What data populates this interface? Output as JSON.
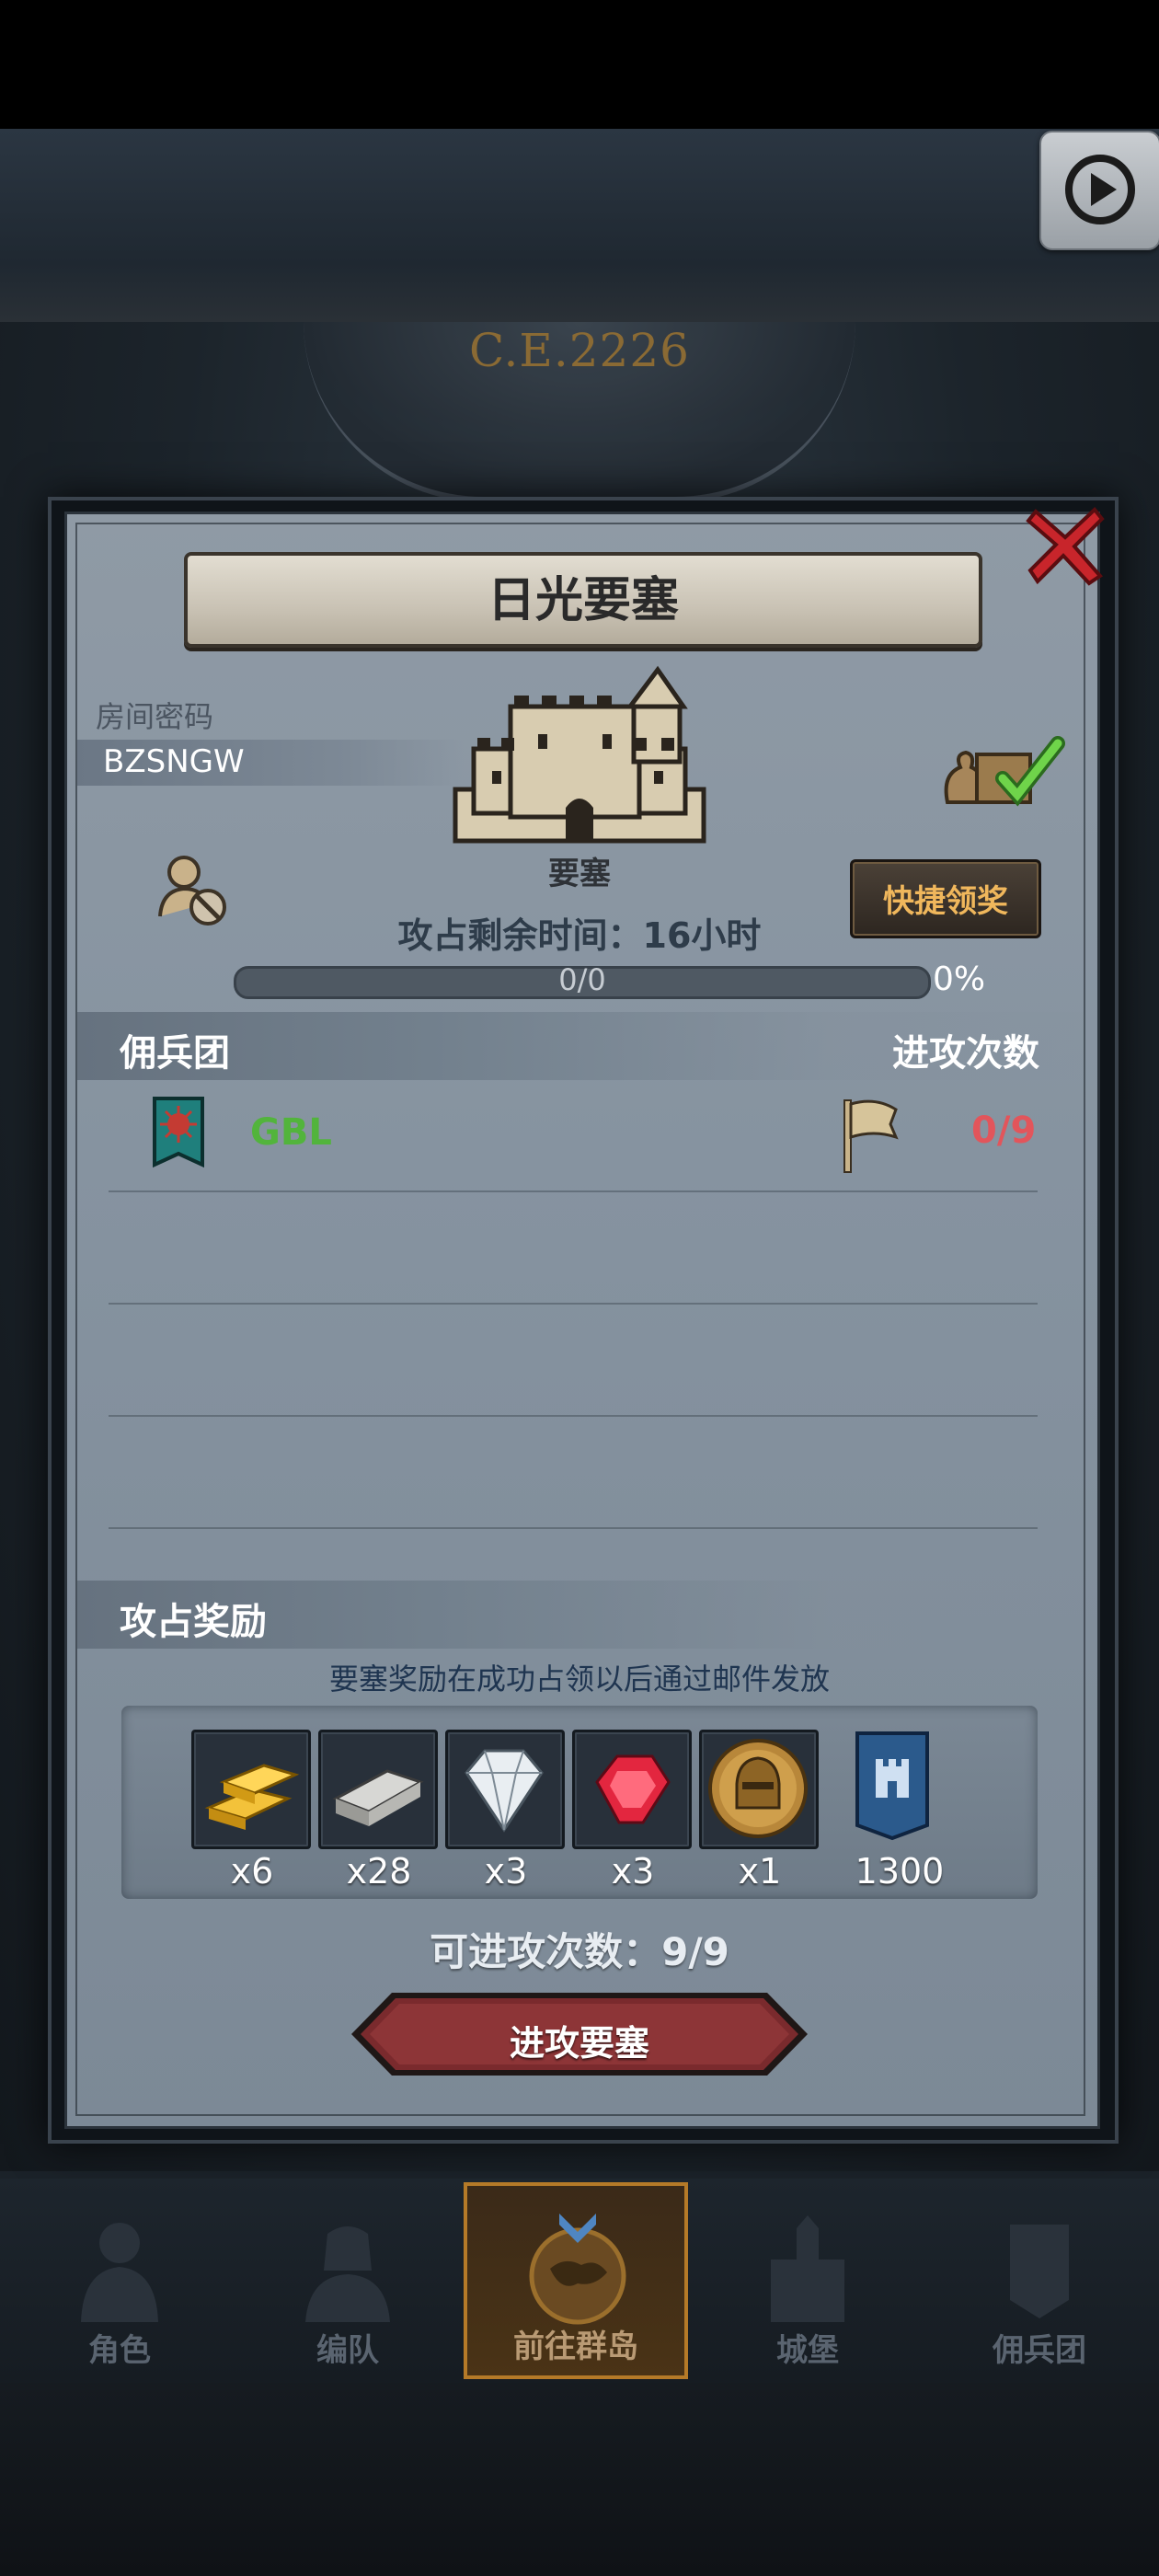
{
  "background": {
    "era_label": "C.E.2226"
  },
  "panel": {
    "title": "日光要塞",
    "room_code_label": "房间密码",
    "room_code": "BZSNGW",
    "fortress_label": "要塞",
    "quick_claim_label": "快捷领奖",
    "remaining_time_text": "攻占剩余时间：16小时",
    "progress": {
      "text": "0/0",
      "percent_text": "0%",
      "value": 0
    }
  },
  "mercenary_section": {
    "title": "佣兵团",
    "right_header": "进攻次数",
    "rows": [
      {
        "guild_name": "GBL",
        "attack_count": "0/9"
      }
    ]
  },
  "reward_section": {
    "title": "攻占奖励",
    "note": "要塞奖励在成功占领以后通过邮件发放",
    "items": [
      {
        "icon": "gold-bar-icon",
        "count": "x6"
      },
      {
        "icon": "iron-bar-icon",
        "count": "x28"
      },
      {
        "icon": "diamond-icon",
        "count": "x3"
      },
      {
        "icon": "ruby-icon",
        "count": "x3"
      },
      {
        "icon": "knight-helmet-coin-icon",
        "count": "x1"
      },
      {
        "icon": "guild-banner-icon",
        "count": "1300"
      }
    ]
  },
  "attempts_text": "可进攻次数：9/9",
  "attack_button_label": "进攻要塞",
  "bottom_nav": {
    "items": [
      {
        "label": "角色",
        "icon": "character-icon"
      },
      {
        "label": "编队",
        "icon": "formation-icon"
      },
      {
        "label": "前往群岛",
        "icon": "islands-globe-icon",
        "active": true
      },
      {
        "label": "城堡",
        "icon": "castle-icon"
      },
      {
        "label": "佣兵团",
        "icon": "mercenary-icon"
      }
    ]
  },
  "colors": {
    "guild_green": "#52b43c",
    "attack_count_red": "#e2555b",
    "quick_claim_gold": "#f0b75c",
    "attack_button_red": "#7a2a2d",
    "nav_active_border": "#b57a28"
  }
}
